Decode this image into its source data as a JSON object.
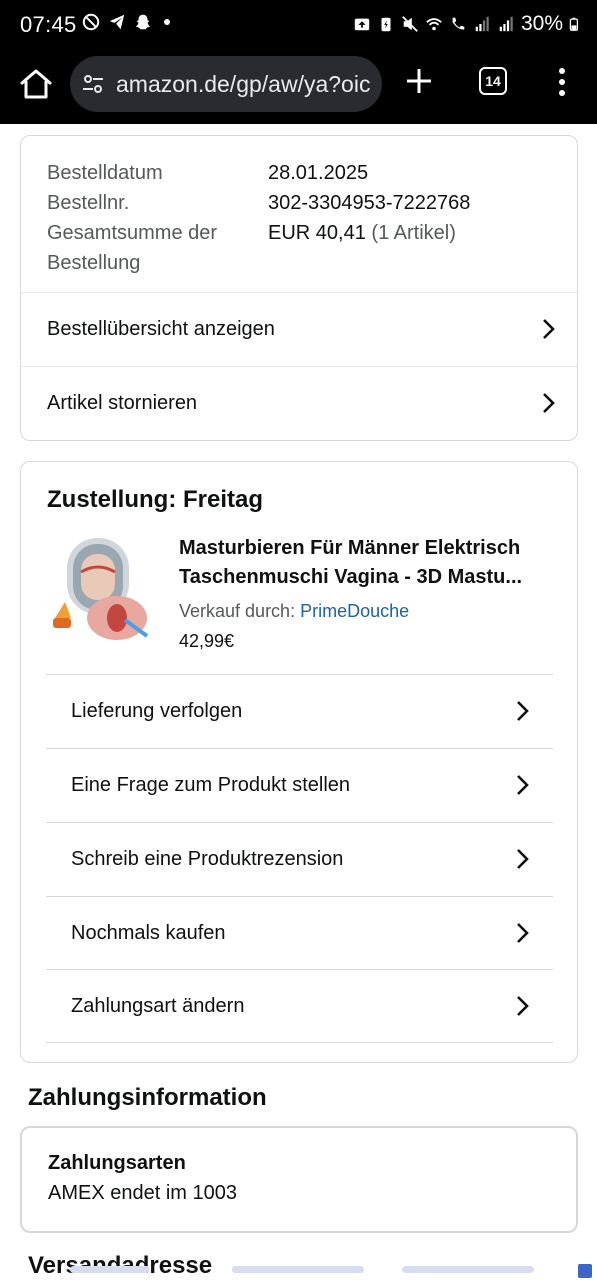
{
  "status_bar": {
    "time": "07:45",
    "battery": "30%"
  },
  "browser": {
    "url": "amazon.de/gp/aw/ya?oic",
    "tab_count": "14"
  },
  "order": {
    "rows": [
      {
        "label": "Bestelldatum",
        "value": "28.01.2025",
        "extra": ""
      },
      {
        "label": "Bestellnr.",
        "value": "302-3304953-7222768",
        "extra": ""
      },
      {
        "label": "Gesamtsumme der",
        "value": "EUR 40,41",
        "extra": "(1 Artikel)"
      },
      {
        "label": "Bestellung",
        "value": "",
        "extra": ""
      }
    ],
    "links": [
      "Bestellübersicht anzeigen",
      "Artikel stornieren"
    ]
  },
  "delivery": {
    "heading": "Zustellung: Freitag",
    "product": {
      "title_line1": "Masturbieren Für Männer Elektrisch",
      "title_line2": "Taschenmuschi Vagina - 3D Mastu...",
      "seller_label": "Verkauf durch:",
      "seller_name": "PrimeDouche",
      "price": "42,99€"
    },
    "actions": [
      "Lieferung verfolgen",
      "Eine Frage zum Produkt stellen",
      "Schreib eine Produktrezension",
      "Nochmals kaufen",
      "Zahlungsart ändern"
    ]
  },
  "payment": {
    "heading": "Zahlungsinformation",
    "methods_label": "Zahlungsarten",
    "method_value": "AMEX  endet im 1003"
  },
  "shipping": {
    "heading": "Versandadresse"
  }
}
